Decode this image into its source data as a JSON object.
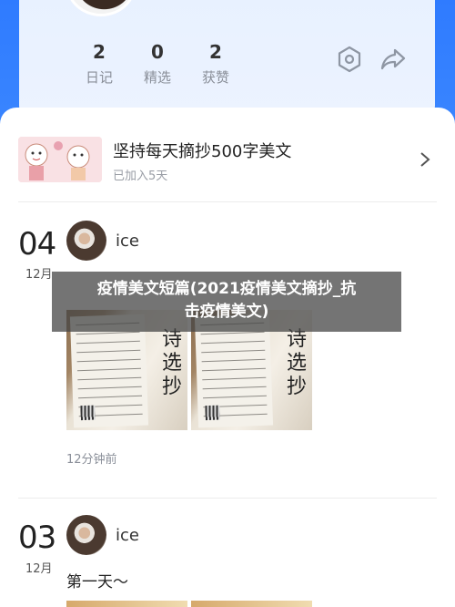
{
  "profile": {
    "name_partial": "ice",
    "stats": [
      {
        "value": "2",
        "label": "日记"
      },
      {
        "value": "0",
        "label": "精选"
      },
      {
        "value": "2",
        "label": "获赞"
      }
    ],
    "actions": [
      "settings-hex-icon",
      "share-icon"
    ]
  },
  "collection": {
    "title": "坚持每天摘抄500字美文",
    "subtitle": "已加入5天"
  },
  "posts": [
    {
      "day": "04",
      "month": "12月",
      "user": "ice",
      "time": "12分钟前"
    },
    {
      "day": "03",
      "month": "12月",
      "user": "ice",
      "text": "第一天～"
    }
  ],
  "overlay": {
    "line1": "疫情美文短篇(2021疫情美文摘抄_抗",
    "line2": "击疫情美文)"
  },
  "colors": {
    "brand_blue": "#2f7bff",
    "card_bg": "#ecf3ff"
  }
}
